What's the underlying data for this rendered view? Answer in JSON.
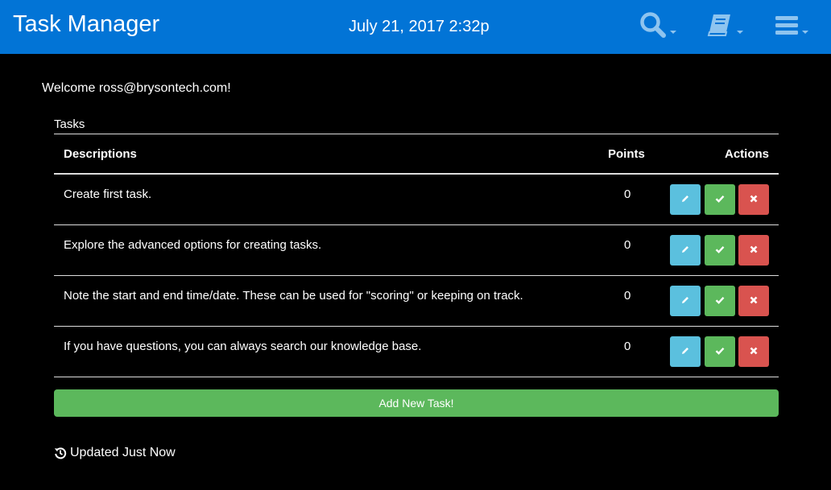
{
  "header": {
    "title": "Task Manager",
    "datetime": "July 21, 2017 2:32p",
    "tools": [
      {
        "icon": "search-icon"
      },
      {
        "icon": "book-icon"
      },
      {
        "icon": "hamburger-menu-icon"
      }
    ],
    "background": "#0274d6",
    "icon_color": "#8ec4ef"
  },
  "welcome": "Welcome ross@brysontech.com!",
  "tasks": {
    "caption": "Tasks",
    "columns": {
      "description": "Descriptions",
      "points": "Points",
      "actions": "Actions"
    },
    "rows": [
      {
        "description": "Create first task.",
        "points": "0"
      },
      {
        "description": "Explore the advanced options for creating tasks.",
        "points": "0"
      },
      {
        "description": "Note the start and end time/date. These can be used for \"scoring\" or keeping on track.",
        "points": "0"
      },
      {
        "description": "If you have questions, you can always search our knowledge base.",
        "points": "0"
      }
    ],
    "action_icons": {
      "edit": "pencil-icon",
      "complete": "check-icon",
      "delete": "x-icon"
    },
    "action_colors": {
      "edit": "#5bc0de",
      "complete": "#5cb85c",
      "delete": "#d9534f"
    }
  },
  "add_button": "Add New Task!",
  "status": {
    "text": "Updated Just Now",
    "icon": "history-icon"
  }
}
